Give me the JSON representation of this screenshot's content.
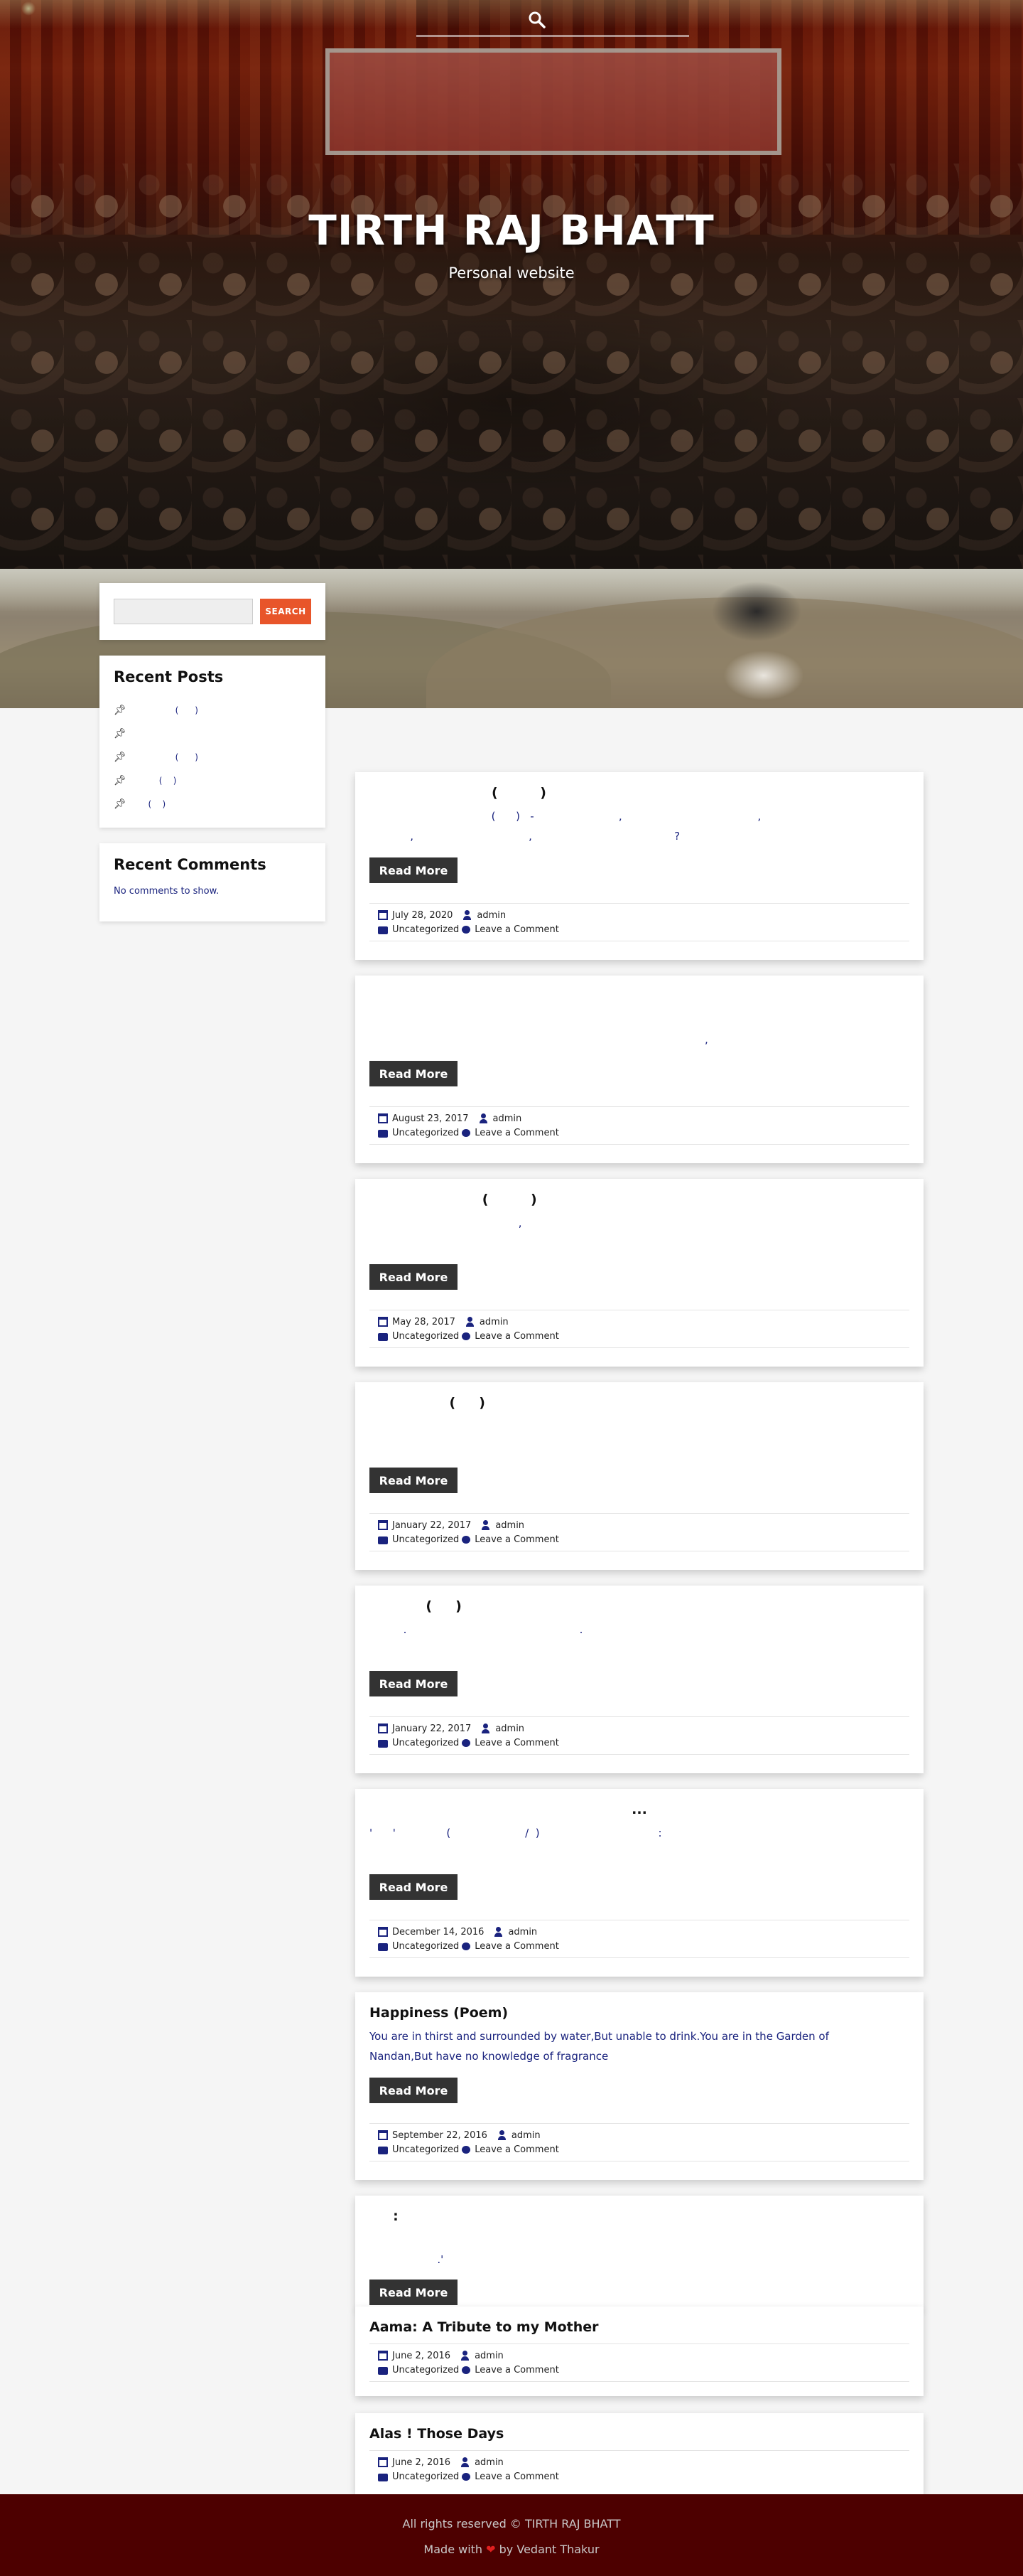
{
  "site": {
    "title": "TIRTH RAJ BHATT",
    "tagline": "Personal website"
  },
  "header": {
    "search_icon": "search-icon"
  },
  "sidebar": {
    "search": {
      "placeholder": "",
      "button_label": "SEARCH"
    },
    "recent_posts": {
      "title": "Recent Posts",
      "items": [
        {
          "icon": "pin-icon",
          "label": "                  (      )"
        },
        {
          "icon": "pin-icon",
          "label": ""
        },
        {
          "icon": "pin-icon",
          "label": "                  (      )"
        },
        {
          "icon": "pin-icon",
          "label": "            (    )"
        },
        {
          "icon": "pin-icon",
          "label": "        (    )"
        }
      ]
    },
    "recent_comments": {
      "title": "Recent Comments",
      "empty_text": "No comments to show."
    }
  },
  "posts": [
    {
      "title": "                          (         )",
      "excerpt": "                                    (      )   -                         ,                                        ,\n            ,                                  ,                                          ?",
      "read_more": "Read More",
      "date": "July 28, 2020",
      "author": "admin",
      "category": "Uncategorized",
      "comment_link": "Leave a Comment"
    },
    {
      "title": "",
      "excerpt": "\n                                                                                                   ,",
      "read_more": "Read More",
      "date": "August 23, 2017",
      "author": "admin",
      "category": "Uncategorized",
      "comment_link": "Leave a Comment"
    },
    {
      "title": "                        (         )",
      "excerpt": "                                            ,",
      "read_more": "Read More",
      "date": "May 28, 2017",
      "author": "admin",
      "category": "Uncategorized",
      "comment_link": "Leave a Comment"
    },
    {
      "title": "                 (     )",
      "excerpt": "",
      "read_more": "Read More",
      "date": "January 22, 2017",
      "author": "admin",
      "category": "Uncategorized",
      "comment_link": "Leave a Comment"
    },
    {
      "title": "            (     )",
      "excerpt": "          .                                                   .",
      "read_more": "Read More",
      "date": "January 22, 2017",
      "author": "admin",
      "category": "Uncategorized",
      "comment_link": "Leave a Comment"
    },
    {
      "title": "...",
      "excerpt": "'      '               (                      /  )                                   :",
      "read_more": "Read More",
      "date": "December 14, 2016",
      "author": "admin",
      "category": "Uncategorized",
      "comment_link": "Leave a Comment"
    },
    {
      "title": "Happiness (Poem)",
      "excerpt": "You are in thirst and surrounded by water,But unable to drink.You are in the Garden of\nNandan,But have no knowledge of fragrance",
      "read_more": "Read More",
      "date": "September 22, 2016",
      "author": "admin",
      "category": "Uncategorized",
      "comment_link": "Leave a Comment"
    },
    {
      "title": "     :",
      "excerpt": "\n                    .'",
      "read_more": "Read More"
    },
    {
      "title": "Aama: A Tribute to my Mother",
      "date": "June 2, 2016",
      "author": "admin",
      "category": "Uncategorized",
      "comment_link": "Leave a Comment"
    },
    {
      "title": "Alas ! Those Days",
      "date": "June 2, 2016",
      "author": "admin",
      "category": "Uncategorized",
      "comment_link": "Leave a Comment"
    }
  ],
  "footer": {
    "copyright": "All rights reserved © TIRTH RAJ BHATT",
    "made_with_prefix": "Made with ",
    "heart": "❤",
    "made_with_suffix": " by Vedant Thakur"
  },
  "colors": {
    "accent": "#e8552a",
    "link": "#1a237e",
    "button_dark": "#333333",
    "footer_bg": "#4d0000"
  }
}
